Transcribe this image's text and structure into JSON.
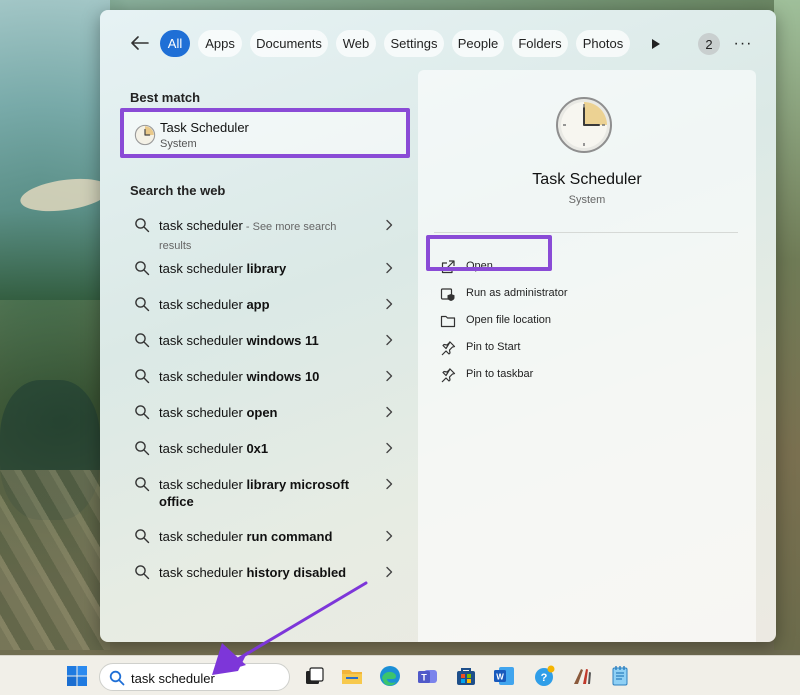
{
  "filters": {
    "back_label": "←",
    "items": [
      {
        "label": "All",
        "active": true
      },
      {
        "label": "Apps",
        "active": false
      },
      {
        "label": "Documents",
        "active": false
      },
      {
        "label": "Web",
        "active": false
      },
      {
        "label": "Settings",
        "active": false
      },
      {
        "label": "People",
        "active": false
      },
      {
        "label": "Folders",
        "active": false
      },
      {
        "label": "Photos",
        "active": false
      }
    ],
    "count_badge": "2",
    "more_label": "···"
  },
  "best_match": {
    "heading": "Best match",
    "title": "Task Scheduler",
    "subtitle": "System"
  },
  "web": {
    "heading": "Search the web",
    "items": [
      {
        "prefix": "task scheduler",
        "bold": "",
        "suffix": " - See more search results"
      },
      {
        "prefix": "task scheduler ",
        "bold": "library",
        "suffix": ""
      },
      {
        "prefix": "task scheduler ",
        "bold": "app",
        "suffix": ""
      },
      {
        "prefix": "task scheduler ",
        "bold": "windows 11",
        "suffix": ""
      },
      {
        "prefix": "task scheduler ",
        "bold": "windows 10",
        "suffix": ""
      },
      {
        "prefix": "task scheduler ",
        "bold": "open",
        "suffix": ""
      },
      {
        "prefix": "task scheduler ",
        "bold": "0x1",
        "suffix": ""
      },
      {
        "prefix": "task scheduler ",
        "bold": "library microsoft office",
        "suffix": ""
      },
      {
        "prefix": "task scheduler ",
        "bold": "run command",
        "suffix": ""
      },
      {
        "prefix": "task scheduler ",
        "bold": "history disabled",
        "suffix": ""
      }
    ]
  },
  "detail": {
    "title": "Task Scheduler",
    "subtitle": "System",
    "actions": [
      {
        "label": "Open",
        "icon": "open-external-icon"
      },
      {
        "label": "Run as administrator",
        "icon": "shield-admin-icon"
      },
      {
        "label": "Open file location",
        "icon": "folder-icon"
      },
      {
        "label": "Pin to Start",
        "icon": "pin-icon"
      },
      {
        "label": "Pin to taskbar",
        "icon": "pin-icon"
      }
    ]
  },
  "taskbar": {
    "search_text": "task scheduler",
    "apps": [
      "task-view-icon",
      "file-explorer-icon",
      "edge-icon",
      "teams-icon",
      "store-icon",
      "word-icon",
      "tips-icon",
      "paint-icon",
      "notepad-icon"
    ]
  },
  "colors": {
    "accent": "#1f6fd6",
    "highlight": "#8a4bd6"
  }
}
